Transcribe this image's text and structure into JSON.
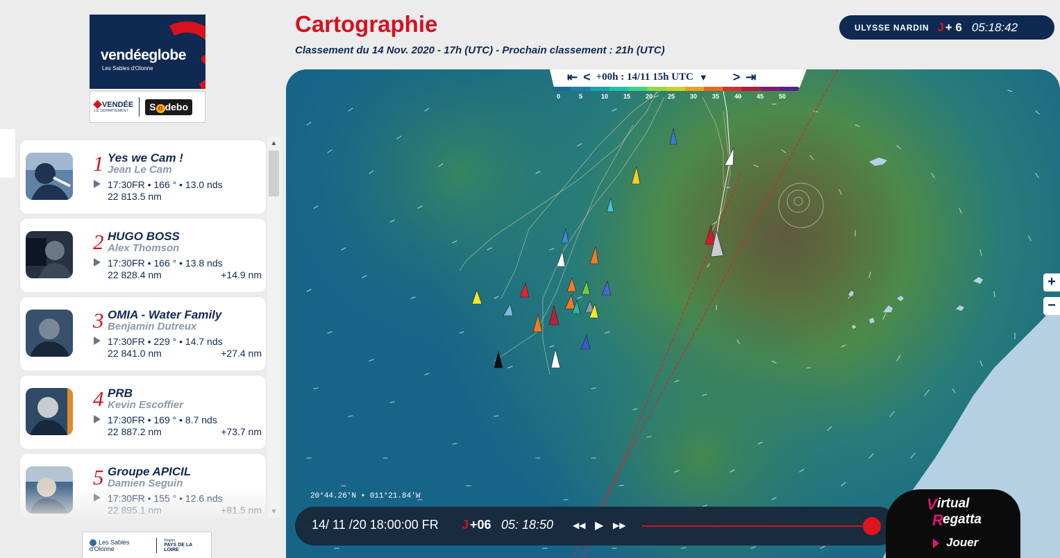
{
  "header": {
    "title": "Cartographie",
    "subtitle": "Classement du 14 Nov. 2020 - 17h (UTC)  -  Prochain classement : 21h (UTC)"
  },
  "logo": {
    "main": "vendéeglobe",
    "sub": "Les Sables d'Olonne",
    "partner1": "VENDÉE",
    "partner1_sub": "LE DÉPARTEMENT",
    "partner2": "Sodebo"
  },
  "clock": {
    "brand": "ULYSSE NARDIN",
    "anchor_icon": "⚓",
    "j_label": "J",
    "j_value": "+ 6",
    "time": "05:18:42"
  },
  "ranking": [
    {
      "rank": "1",
      "boat": "Yes we Cam !",
      "skipper": "Jean Le Cam",
      "stats": "17:30FR • 166 ° • 13.0 nds",
      "distance": "22 813.5 nm",
      "gap": ""
    },
    {
      "rank": "2",
      "boat": "HUGO BOSS",
      "skipper": "Alex Thomson",
      "stats": "17:30FR • 166 ° • 13.8 nds",
      "distance": "22 828.4 nm",
      "gap": "+14.9 nm"
    },
    {
      "rank": "3",
      "boat": "OMIA - Water Family",
      "skipper": "Benjamin Dutreux",
      "stats": "17:30FR • 229 ° • 14.7 nds",
      "distance": "22 841.0 nm",
      "gap": "+27.4 nm"
    },
    {
      "rank": "4",
      "boat": "PRB",
      "skipper": "Kevin Escoffier",
      "stats": "17:30FR • 169 ° • 8.7 nds",
      "distance": "22 887.2 nm",
      "gap": "+73.7 nm"
    },
    {
      "rank": "5",
      "boat": "Groupe APICIL",
      "skipper": "Damien Seguin",
      "stats": "17:30FR • 155 ° • 12.6 nds",
      "distance": "22 895.1 nm",
      "gap": "+81.5 nm"
    }
  ],
  "footer_logo": {
    "left": "Les Sables d'Olonne",
    "right": "PAYS DE LA LOIRE",
    "right_small": "Région"
  },
  "map": {
    "time_control": {
      "first": "K",
      "prev": "<",
      "label": "+00h : 14/11 15h UTC",
      "dropdown": "▼",
      "next": ">",
      "last": "K"
    },
    "wind_scale": {
      "labels": [
        "0",
        "5",
        "10",
        "15",
        "20",
        "25",
        "30",
        "35",
        "40",
        "45",
        "50"
      ],
      "colors": [
        "#1d6a93",
        "#1c7fa3",
        "#1fa0b0",
        "#1fc0b0",
        "#3fd28a",
        "#92d64a",
        "#d2cf2c",
        "#e8a324",
        "#e56a22",
        "#d2322b",
        "#b01c3e",
        "#7f1b6a",
        "#5b1d8a"
      ]
    },
    "coords": "20°44.26'N • 011°21.84'W",
    "zoom_in": "+",
    "zoom_out": "−",
    "colors": {
      "sea_deep": "#15557f",
      "sea_mid": "#1a7d8c",
      "wind_high": "#6b9b3f",
      "land": "#b6d0e3"
    }
  },
  "playback": {
    "date": "14/ 11 /20  18:00:00 FR",
    "j_label": "J",
    "j_value": "+06",
    "time": "05: 18:50",
    "rewind_icon": "◀◀",
    "play_icon": "▶",
    "forward_icon": "▶▶",
    "progress": 0.98
  },
  "virtual_regatta": {
    "v": "V",
    "line1": "irtual",
    "r": "R",
    "line2": "egatta",
    "cta": "Jouer"
  }
}
